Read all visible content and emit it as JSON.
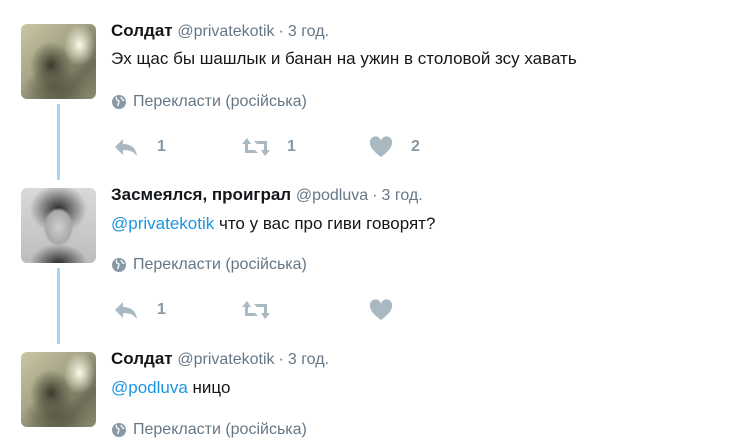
{
  "colors": {
    "mention": "#1b95e0",
    "muted": "#657786",
    "action_icon": "#aab8c2",
    "thread_line": "#a4d2ef"
  },
  "tweets": [
    {
      "name": "Солдат",
      "handle": "@privatekotik",
      "time": "3 год.",
      "mention": "",
      "text": "Эх щас бы шашлык и банан на ужин в столовой зсу хавать",
      "translate": "Перекласти (російська)",
      "reply_count": "1",
      "retweet_count": "1",
      "like_count": "2"
    },
    {
      "name": "Засмеялся, проиграл",
      "handle": "@podluva",
      "time": "3 год.",
      "mention": "@privatekotik",
      "text": " что у вас про гиви говорят?",
      "translate": "Перекласти (російська)",
      "reply_count": "1",
      "retweet_count": "",
      "like_count": ""
    },
    {
      "name": "Солдат",
      "handle": "@privatekotik",
      "time": "3 год.",
      "mention": "@podluva",
      "text": " ницо",
      "translate": "Перекласти (російська)"
    }
  ],
  "icons": {
    "globe": "globe-icon",
    "reply": "reply-icon",
    "retweet": "retweet-icon",
    "like": "heart-icon"
  }
}
